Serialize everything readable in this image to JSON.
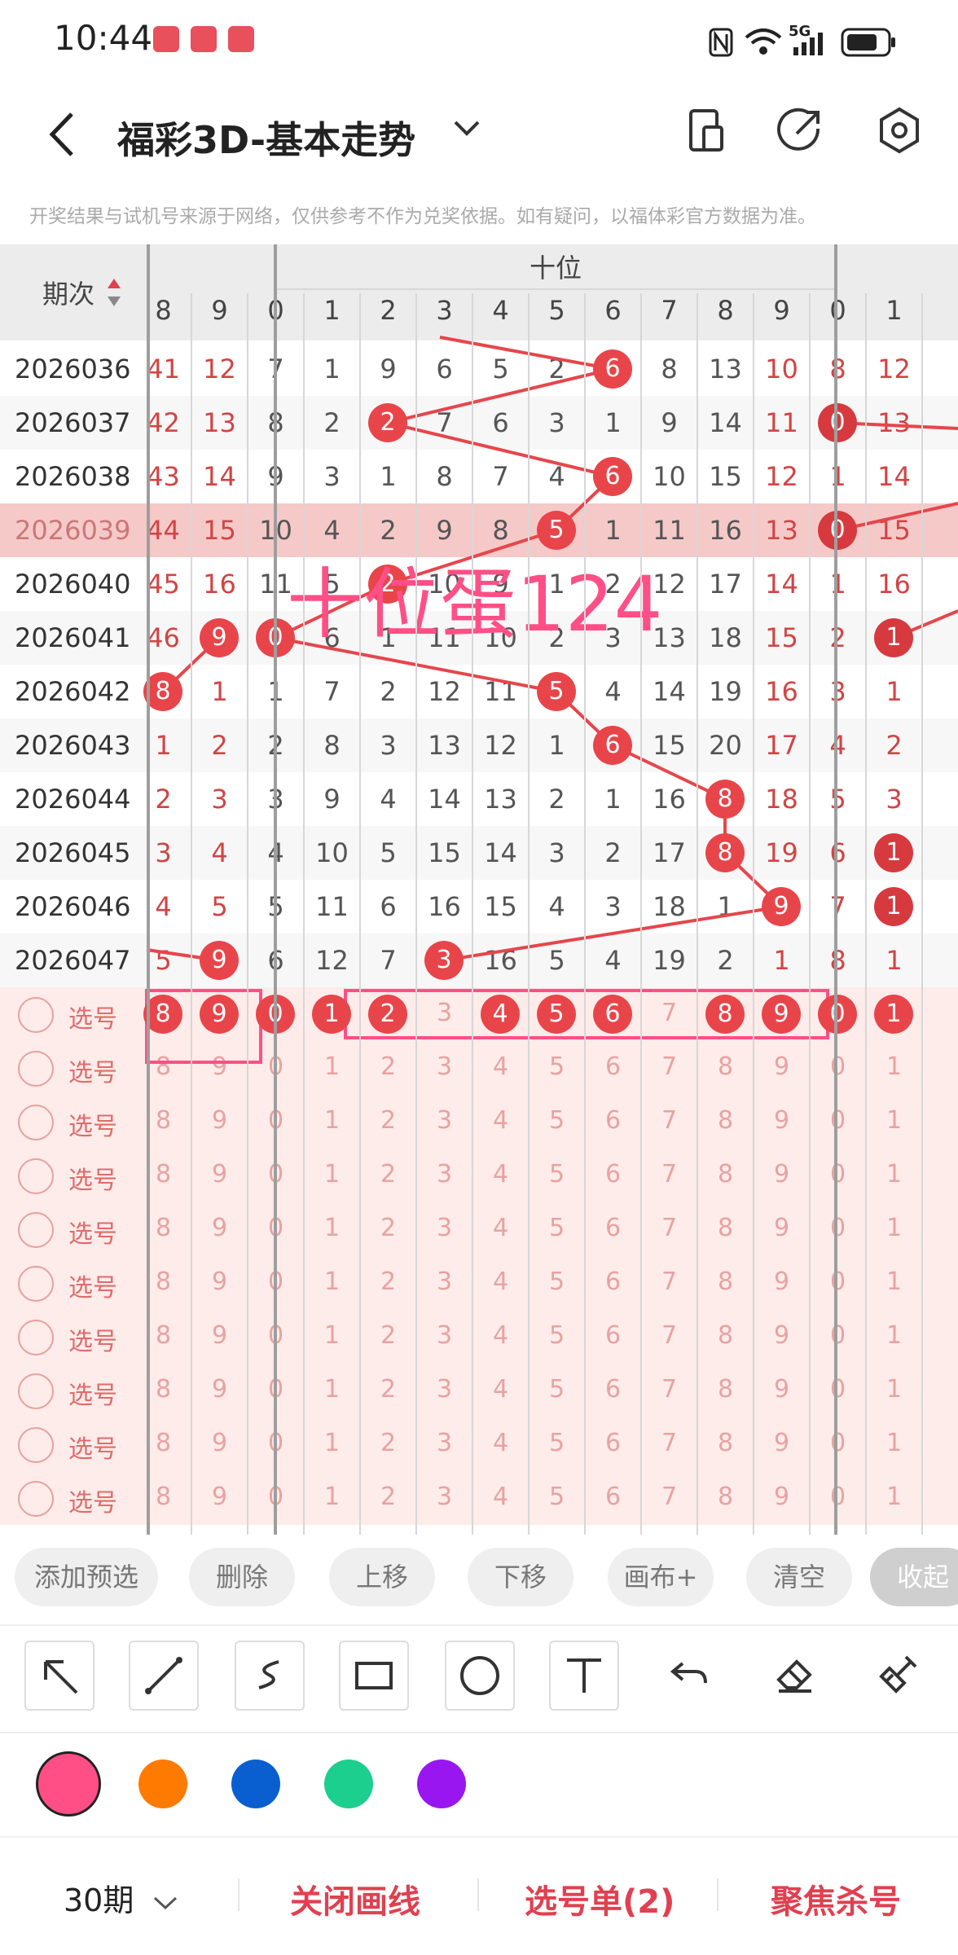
{
  "status": {
    "time": "10:44",
    "network": "5G"
  },
  "header": {
    "title": "福彩3D-基本走势"
  },
  "disclaimer": "开奖结果与试机号来源于网络，仅供参考不作为兑奖依据。如有疑问，以福体彩官方数据为准。",
  "table": {
    "period_header": "期次",
    "group_label": "十位",
    "left_digits": [
      "8",
      "9"
    ],
    "ten_digits": [
      "0",
      "1",
      "2",
      "3",
      "4",
      "5",
      "6",
      "7",
      "8",
      "9"
    ],
    "right_digits": [
      "0",
      "1"
    ],
    "rows": [
      {
        "period": "2026036",
        "cells": [
          "41",
          "12",
          "7",
          "1",
          "9",
          "6",
          "5",
          "2",
          "6",
          "8",
          "13",
          "10",
          "8",
          "12"
        ]
      },
      {
        "period": "2026037",
        "cells": [
          "42",
          "13",
          "8",
          "2",
          "2",
          "7",
          "6",
          "3",
          "1",
          "9",
          "14",
          "11",
          "0",
          "13"
        ]
      },
      {
        "period": "2026038",
        "cells": [
          "43",
          "14",
          "9",
          "3",
          "1",
          "8",
          "7",
          "4",
          "6",
          "10",
          "15",
          "12",
          "1",
          "14"
        ]
      },
      {
        "period": "2026039",
        "cells": [
          "44",
          "15",
          "10",
          "4",
          "2",
          "9",
          "8",
          "5",
          "1",
          "11",
          "16",
          "13",
          "0",
          "15"
        ]
      },
      {
        "period": "2026040",
        "cells": [
          "45",
          "16",
          "11",
          "5",
          "2",
          "10",
          "9",
          "1",
          "2",
          "12",
          "17",
          "14",
          "1",
          "16"
        ]
      },
      {
        "period": "2026041",
        "cells": [
          "46",
          "9",
          "0",
          "6",
          "1",
          "11",
          "10",
          "2",
          "3",
          "13",
          "18",
          "15",
          "2",
          "1"
        ]
      },
      {
        "period": "2026042",
        "cells": [
          "8",
          "1",
          "1",
          "7",
          "2",
          "12",
          "11",
          "5",
          "4",
          "14",
          "19",
          "16",
          "3",
          "1"
        ]
      },
      {
        "period": "2026043",
        "cells": [
          "1",
          "2",
          "2",
          "8",
          "3",
          "13",
          "12",
          "1",
          "6",
          "15",
          "20",
          "17",
          "4",
          "2"
        ]
      },
      {
        "period": "2026044",
        "cells": [
          "2",
          "3",
          "3",
          "9",
          "4",
          "14",
          "13",
          "2",
          "1",
          "16",
          "8",
          "18",
          "5",
          "3"
        ]
      },
      {
        "period": "2026045",
        "cells": [
          "3",
          "4",
          "4",
          "10",
          "5",
          "15",
          "14",
          "3",
          "2",
          "17",
          "8",
          "19",
          "6",
          "1"
        ]
      },
      {
        "period": "2026046",
        "cells": [
          "4",
          "5",
          "5",
          "11",
          "6",
          "16",
          "15",
          "4",
          "3",
          "18",
          "1",
          "9",
          "7",
          "1"
        ]
      },
      {
        "period": "2026047",
        "cells": [
          "5",
          "9",
          "6",
          "12",
          "7",
          "3",
          "16",
          "5",
          "4",
          "19",
          "2",
          "1",
          "8",
          "1"
        ]
      }
    ],
    "annotation": "十位蛋124",
    "select_label": "选号",
    "selected_row": [
      "8",
      "9",
      "0",
      "1",
      "2",
      "3",
      "4",
      "5",
      "6",
      "7",
      "8",
      "9",
      "0",
      "1"
    ]
  },
  "actions": [
    "添加预选",
    "删除",
    "上移",
    "下移",
    "画布+",
    "清空",
    "收起"
  ],
  "tools": [
    "arrow-icon",
    "line-icon",
    "curve-icon",
    "rectangle-icon",
    "circle-icon",
    "text-icon",
    "undo-icon",
    "eraser-icon",
    "clear-icon"
  ],
  "palette": [
    "#ff4f86",
    "#ff7a00",
    "#0a5fd0",
    "#1ccf8e",
    "#9a16f0"
  ],
  "bottom": {
    "periods": "30期",
    "close_draw": "关闭画线",
    "select_list": "选号单(2)",
    "focus_kill": "聚焦杀号"
  }
}
